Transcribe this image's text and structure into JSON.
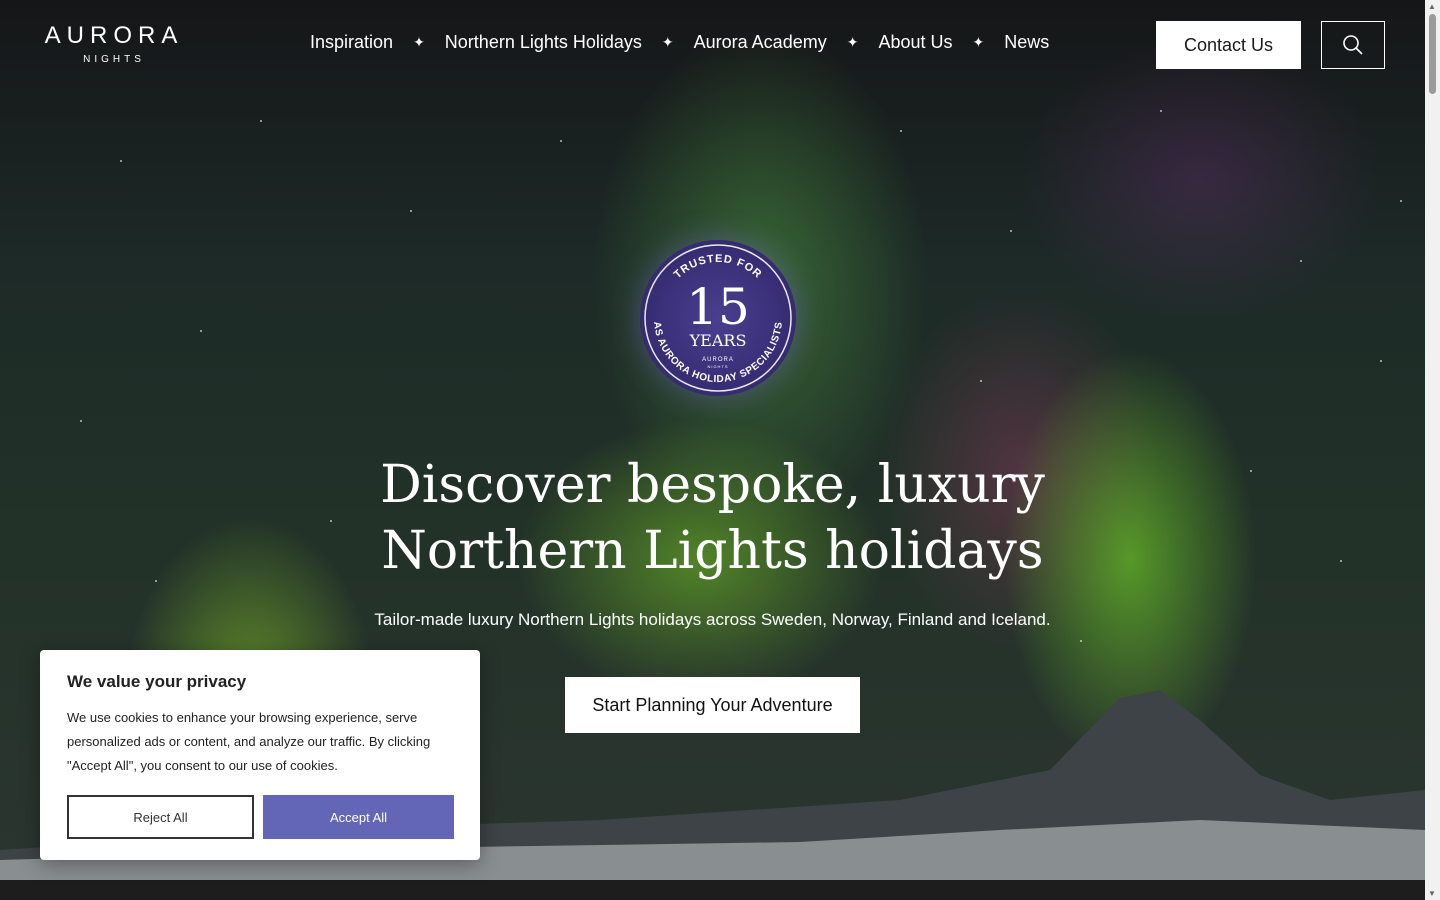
{
  "brand": {
    "name": "AURORA",
    "sub": "NIGHTS"
  },
  "nav": {
    "items": [
      {
        "label": "Inspiration"
      },
      {
        "label": "Northern Lights Holidays"
      },
      {
        "label": "Aurora Academy"
      },
      {
        "label": "About Us"
      },
      {
        "label": "News"
      }
    ],
    "separator": "✦"
  },
  "header": {
    "contact_label": "Contact Us",
    "search_icon": "search-icon"
  },
  "badge": {
    "top_text": "TRUSTED FOR",
    "number": "15",
    "unit": "YEARS",
    "brand": "AURORA",
    "brand_sub": "NIGHTS",
    "bottom_text": "AS AURORA HOLIDAY SPECIALISTS"
  },
  "hero": {
    "title_line1": "Discover bespoke, luxury",
    "title_line2": "Northern Lights holidays",
    "subtitle": "Tailor-made luxury Northern Lights holidays across Sweden, Norway, Finland and Iceland.",
    "cta_label": "Start Planning Your Adventure"
  },
  "cookie": {
    "title": "We value your privacy",
    "text": "We use cookies to enhance your browsing experience, serve personalized ads or content, and analyze our traffic. By clicking \"Accept All\", you consent to our use of cookies.",
    "reject_label": "Reject All",
    "accept_label": "Accept All"
  },
  "colors": {
    "accent": "#6366b6",
    "badge": "#3a2f78",
    "aurora_green": "#8ccf30"
  }
}
